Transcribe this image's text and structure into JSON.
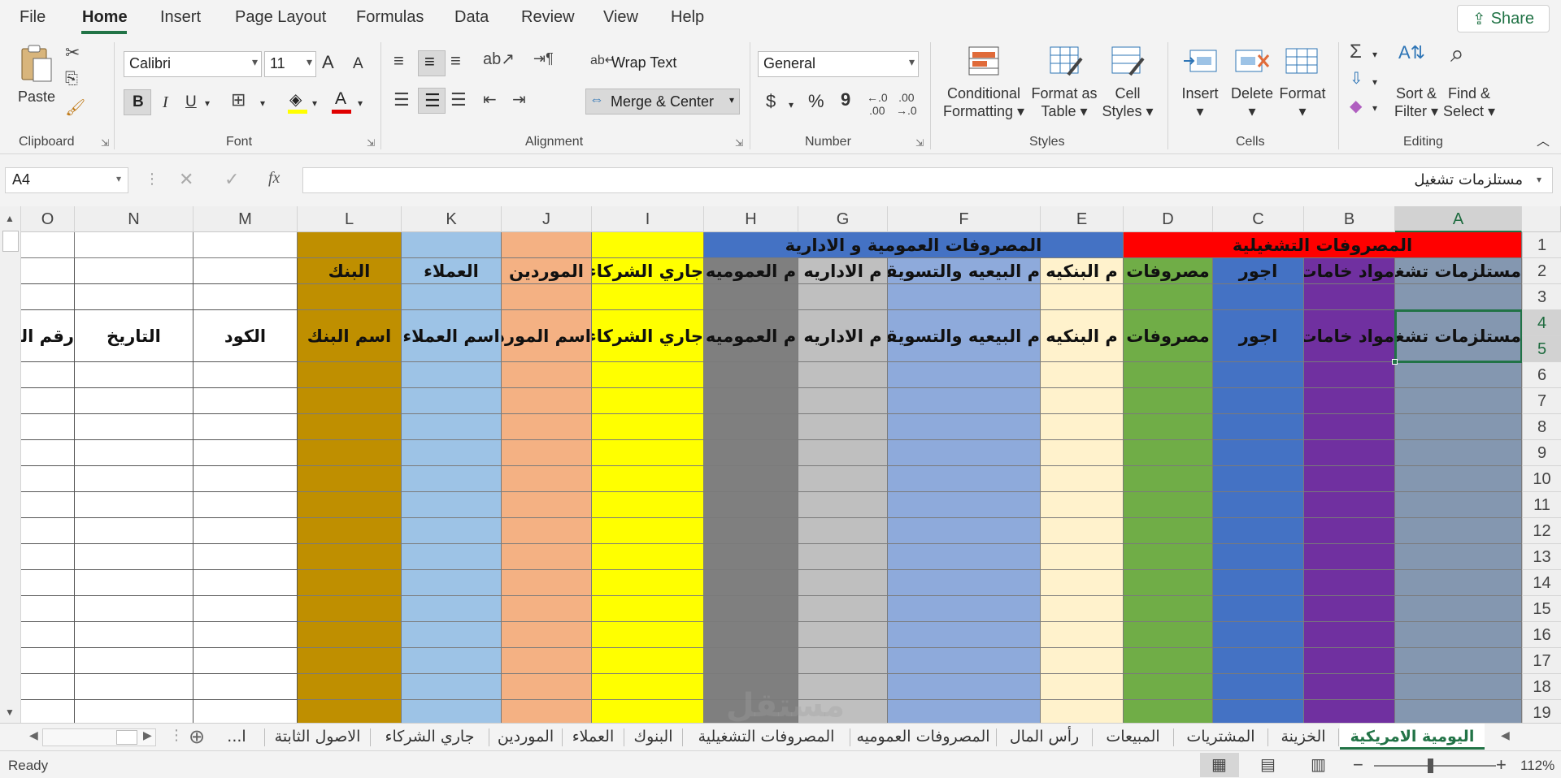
{
  "menu": {
    "tabs": [
      "File",
      "Home",
      "Insert",
      "Page Layout",
      "Formulas",
      "Data",
      "Review",
      "View",
      "Help"
    ],
    "share": "Share"
  },
  "ribbon": {
    "clipboard": {
      "paste": "Paste",
      "label": "Clipboard"
    },
    "font": {
      "name": "Calibri",
      "size": "11",
      "bold": "B",
      "italic": "I",
      "underline": "U",
      "grow": "A",
      "shrink": "A",
      "color_letter": "A",
      "label": "Font"
    },
    "alignment": {
      "wrap_text": "Wrap Text",
      "merge_center": "Merge & Center",
      "label": "Alignment"
    },
    "number": {
      "format": "General",
      "currency": "$",
      "percent": "%",
      "comma": "9",
      "label": "Number"
    },
    "styles": {
      "cond_fmt": [
        "Conditional",
        "Formatting"
      ],
      "fmt_table": [
        "Format as",
        "Table"
      ],
      "cell_styles": [
        "Cell",
        "Styles"
      ],
      "label": "Styles"
    },
    "cells": {
      "insert": "Insert",
      "delete": "Delete",
      "format": "Format",
      "label": "Cells"
    },
    "editing": {
      "sort": [
        "Sort &",
        "Filter"
      ],
      "find": [
        "Find &",
        "Select"
      ],
      "label": "Editing"
    }
  },
  "formula_bar": {
    "name_box": "A4",
    "fx": "fx",
    "value": "مستلزمات تشغيل"
  },
  "grid": {
    "columns": [
      "O",
      "N",
      "M",
      "L",
      "K",
      "J",
      "I",
      "H",
      "G",
      "F",
      "E",
      "D",
      "C",
      "B",
      "A"
    ],
    "rows": [
      "1",
      "2",
      "3",
      "4",
      "5",
      "6",
      "7",
      "8",
      "9",
      "10",
      "11",
      "12",
      "13",
      "14",
      "15",
      "16",
      "17",
      "18",
      "19"
    ],
    "selected_column": "A",
    "selected_rows": [
      "4",
      "5"
    ],
    "row1": {
      "admin_group": "المصروفات العمومية و الادارية",
      "operating_group": "المصروفات التشغيلية"
    },
    "row2": {
      "L": "البنك",
      "K": "العملاء",
      "J": "الموردين",
      "I": "جاري الشركاء",
      "H": "م العموميه",
      "G": "م الاداريه",
      "F": "م البيعيه والتسويقيه",
      "E": "م البنكيه",
      "D": "مصروفات",
      "C": "اجور",
      "B": "مواد خامات",
      "A": "مستلزمات تشغيل"
    },
    "row4": {
      "O": "رقم القيد",
      "N": "التاريخ",
      "M": "الكود",
      "L": "اسم البنك",
      "K": "اسم العملاء",
      "J": "اسم المورد",
      "I": "جاري الشركاء",
      "H": "م العموميه",
      "G": "م الاداريه",
      "F": "م البيعيه والتسويقيه",
      "E": "م البنكيه",
      "D": "مصروفات",
      "C": "اجور",
      "B": "مواد خامات",
      "A": "مستلزمات تشغيل"
    },
    "colors": {
      "L": "#bf8f00",
      "K": "#9dc3e6",
      "J": "#f4b183",
      "I": "#ffff00",
      "H": "#7f7f7f",
      "G": "#bfbfbf",
      "F": "#8eaadb",
      "E": "#fff2cc",
      "D": "#70ad47",
      "C": "#4472c4",
      "B": "#7030a0",
      "A": "#8497b0",
      "admin_header": "#4472c4",
      "operating_header": "#ff0000"
    }
  },
  "sheet_tabs": [
    "اليومية الامريكية",
    "الخزينة",
    "المشتريات",
    "المبيعات",
    "رأس المال",
    "المصروفات العموميه",
    "المصروفات التشغيلية",
    "البنوك",
    "العملاء",
    "الموردين",
    "جاري الشركاء",
    "الاصول الثابتة",
    "ا..."
  ],
  "status": {
    "ready": "Ready",
    "zoom": "112%"
  }
}
